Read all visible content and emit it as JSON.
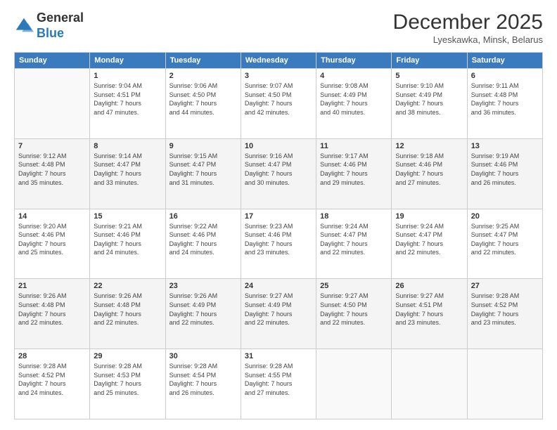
{
  "logo": {
    "general": "General",
    "blue": "Blue"
  },
  "title": "December 2025",
  "subtitle": "Lyeskawka, Minsk, Belarus",
  "weekdays": [
    "Sunday",
    "Monday",
    "Tuesday",
    "Wednesday",
    "Thursday",
    "Friday",
    "Saturday"
  ],
  "weeks": [
    [
      {
        "day": "",
        "info": ""
      },
      {
        "day": "1",
        "info": "Sunrise: 9:04 AM\nSunset: 4:51 PM\nDaylight: 7 hours\nand 47 minutes."
      },
      {
        "day": "2",
        "info": "Sunrise: 9:06 AM\nSunset: 4:50 PM\nDaylight: 7 hours\nand 44 minutes."
      },
      {
        "day": "3",
        "info": "Sunrise: 9:07 AM\nSunset: 4:50 PM\nDaylight: 7 hours\nand 42 minutes."
      },
      {
        "day": "4",
        "info": "Sunrise: 9:08 AM\nSunset: 4:49 PM\nDaylight: 7 hours\nand 40 minutes."
      },
      {
        "day": "5",
        "info": "Sunrise: 9:10 AM\nSunset: 4:49 PM\nDaylight: 7 hours\nand 38 minutes."
      },
      {
        "day": "6",
        "info": "Sunrise: 9:11 AM\nSunset: 4:48 PM\nDaylight: 7 hours\nand 36 minutes."
      }
    ],
    [
      {
        "day": "7",
        "info": "Sunrise: 9:12 AM\nSunset: 4:48 PM\nDaylight: 7 hours\nand 35 minutes."
      },
      {
        "day": "8",
        "info": "Sunrise: 9:14 AM\nSunset: 4:47 PM\nDaylight: 7 hours\nand 33 minutes."
      },
      {
        "day": "9",
        "info": "Sunrise: 9:15 AM\nSunset: 4:47 PM\nDaylight: 7 hours\nand 31 minutes."
      },
      {
        "day": "10",
        "info": "Sunrise: 9:16 AM\nSunset: 4:47 PM\nDaylight: 7 hours\nand 30 minutes."
      },
      {
        "day": "11",
        "info": "Sunrise: 9:17 AM\nSunset: 4:46 PM\nDaylight: 7 hours\nand 29 minutes."
      },
      {
        "day": "12",
        "info": "Sunrise: 9:18 AM\nSunset: 4:46 PM\nDaylight: 7 hours\nand 27 minutes."
      },
      {
        "day": "13",
        "info": "Sunrise: 9:19 AM\nSunset: 4:46 PM\nDaylight: 7 hours\nand 26 minutes."
      }
    ],
    [
      {
        "day": "14",
        "info": "Sunrise: 9:20 AM\nSunset: 4:46 PM\nDaylight: 7 hours\nand 25 minutes."
      },
      {
        "day": "15",
        "info": "Sunrise: 9:21 AM\nSunset: 4:46 PM\nDaylight: 7 hours\nand 24 minutes."
      },
      {
        "day": "16",
        "info": "Sunrise: 9:22 AM\nSunset: 4:46 PM\nDaylight: 7 hours\nand 24 minutes."
      },
      {
        "day": "17",
        "info": "Sunrise: 9:23 AM\nSunset: 4:46 PM\nDaylight: 7 hours\nand 23 minutes."
      },
      {
        "day": "18",
        "info": "Sunrise: 9:24 AM\nSunset: 4:47 PM\nDaylight: 7 hours\nand 22 minutes."
      },
      {
        "day": "19",
        "info": "Sunrise: 9:24 AM\nSunset: 4:47 PM\nDaylight: 7 hours\nand 22 minutes."
      },
      {
        "day": "20",
        "info": "Sunrise: 9:25 AM\nSunset: 4:47 PM\nDaylight: 7 hours\nand 22 minutes."
      }
    ],
    [
      {
        "day": "21",
        "info": "Sunrise: 9:26 AM\nSunset: 4:48 PM\nDaylight: 7 hours\nand 22 minutes."
      },
      {
        "day": "22",
        "info": "Sunrise: 9:26 AM\nSunset: 4:48 PM\nDaylight: 7 hours\nand 22 minutes."
      },
      {
        "day": "23",
        "info": "Sunrise: 9:26 AM\nSunset: 4:49 PM\nDaylight: 7 hours\nand 22 minutes."
      },
      {
        "day": "24",
        "info": "Sunrise: 9:27 AM\nSunset: 4:49 PM\nDaylight: 7 hours\nand 22 minutes."
      },
      {
        "day": "25",
        "info": "Sunrise: 9:27 AM\nSunset: 4:50 PM\nDaylight: 7 hours\nand 22 minutes."
      },
      {
        "day": "26",
        "info": "Sunrise: 9:27 AM\nSunset: 4:51 PM\nDaylight: 7 hours\nand 23 minutes."
      },
      {
        "day": "27",
        "info": "Sunrise: 9:28 AM\nSunset: 4:52 PM\nDaylight: 7 hours\nand 23 minutes."
      }
    ],
    [
      {
        "day": "28",
        "info": "Sunrise: 9:28 AM\nSunset: 4:52 PM\nDaylight: 7 hours\nand 24 minutes."
      },
      {
        "day": "29",
        "info": "Sunrise: 9:28 AM\nSunset: 4:53 PM\nDaylight: 7 hours\nand 25 minutes."
      },
      {
        "day": "30",
        "info": "Sunrise: 9:28 AM\nSunset: 4:54 PM\nDaylight: 7 hours\nand 26 minutes."
      },
      {
        "day": "31",
        "info": "Sunrise: 9:28 AM\nSunset: 4:55 PM\nDaylight: 7 hours\nand 27 minutes."
      },
      {
        "day": "",
        "info": ""
      },
      {
        "day": "",
        "info": ""
      },
      {
        "day": "",
        "info": ""
      }
    ]
  ]
}
